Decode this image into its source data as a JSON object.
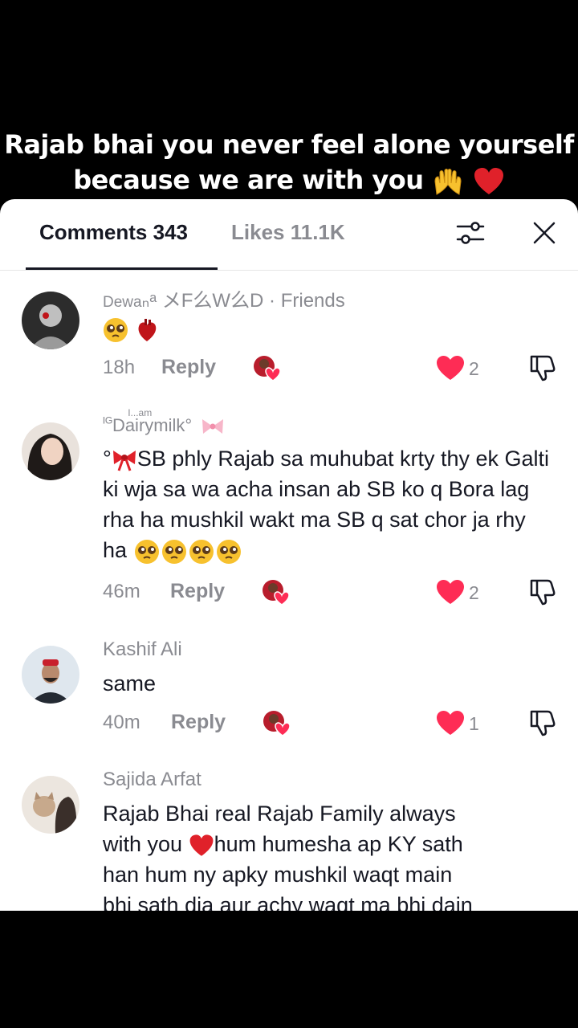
{
  "caption": {
    "line1": "Rajab bhai you never feel alone yourself",
    "line2": "because we are with you"
  },
  "tabs": {
    "comments": "Comments 343",
    "likes": "Likes 11.1K"
  },
  "icons": {
    "filter": "sliders-icon",
    "close": "close-icon",
    "like": "heart-icon",
    "dislike": "thumbs-down-icon",
    "creator_like": "creator-liked-icon"
  },
  "colors": {
    "like_red": "#fe2c55",
    "muted": "#8a8b91",
    "text": "#161823"
  },
  "comments": [
    {
      "author_name": "Dewa",
      "author_mid": "ₙᵃ メF么W么D",
      "author_suffix": " · Friends",
      "text": "",
      "time": "18h",
      "reply": "Reply",
      "likes": "2"
    },
    {
      "author_prefix": "ᴵᴳ",
      "author_name": "Dairymilk°",
      "author_sup": "I...am",
      "text_prefix": "°",
      "text": "SB phly Rajab sa muhubat krty thy ek Galti ki wja sa wa acha insan ab SB ko q Bora lag rha ha mushkil wakt ma SB q sat chor ja rhy ha",
      "time": "46m",
      "reply": "Reply",
      "likes": "2"
    },
    {
      "author_name": "Kashif Ali",
      "text": "same",
      "time": "40m",
      "reply": "Reply",
      "likes": "1"
    },
    {
      "author_name": "Sajida Arfat",
      "text_a": "Rajab Bhai real Rajab Family always",
      "text_b1": "with you ",
      "text_b2": "hum humesha ap KY sath",
      "text_c": "han hum ny apky mushkil waqt main",
      "text_d": "bhi sath dia aur achy waqt ma bhi dain"
    }
  ]
}
